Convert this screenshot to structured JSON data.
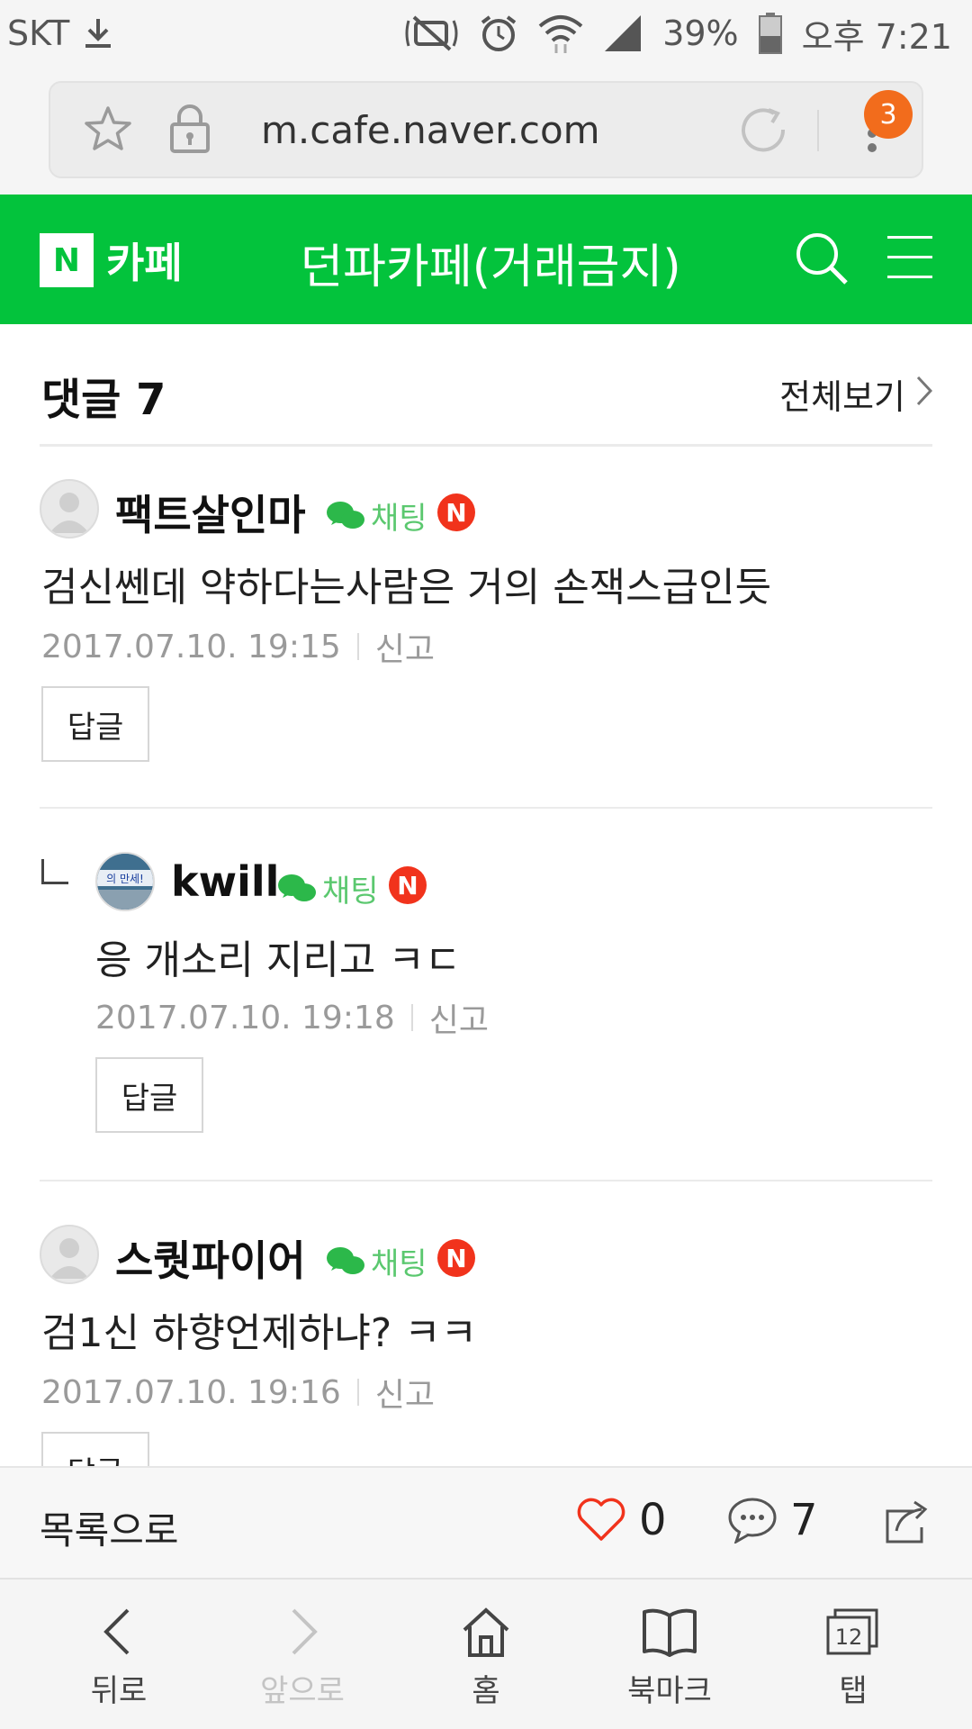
{
  "statusbar": {
    "carrier": "SKT",
    "battery": "39%",
    "time": "오후 7:21"
  },
  "browser": {
    "url": "m.cafe.naver.com",
    "tab_badge": "3"
  },
  "header": {
    "logo_letter": "N",
    "logo_label": "카페",
    "title": "던파카페(거래금지)"
  },
  "comments_header": {
    "title": "댓글 7",
    "view_all": "전체보기"
  },
  "comments": [
    {
      "nick": "팩트살인마",
      "chat_label": "채팅",
      "badge": "N",
      "text": "검신쎈데 약하다는사람은 거의 손잭스급인듯",
      "date": "2017.07.10. 19:15",
      "report": "신고",
      "reply_btn": "답글"
    },
    {
      "nick": "kwill",
      "chat_label": "채팅",
      "badge": "N",
      "avatar_text": "의 만세!",
      "text": "응 개소리 지리고 ㅋㄷ",
      "date": "2017.07.10. 19:18",
      "report": "신고",
      "reply_btn": "답글"
    },
    {
      "nick": "스퀏파이어",
      "chat_label": "채팅",
      "badge": "N",
      "text": "검1신 하향언제하냐? ㅋㅋ",
      "date": "2017.07.10. 19:16",
      "report": "신고",
      "reply_btn": "답글"
    }
  ],
  "cafebar": {
    "list_label": "목록으로",
    "likes": "0",
    "comment_count": "7"
  },
  "navbar": {
    "back": "뒤로",
    "forward": "앞으로",
    "home": "홈",
    "bookmarks": "북마크",
    "tabs": "탭",
    "tab_count": "12"
  },
  "colors": {
    "brand_green": "#03c33c",
    "badge_red": "#f1331c",
    "tab_badge_orange": "#f26c1c",
    "chat_green": "#5bc86f"
  }
}
